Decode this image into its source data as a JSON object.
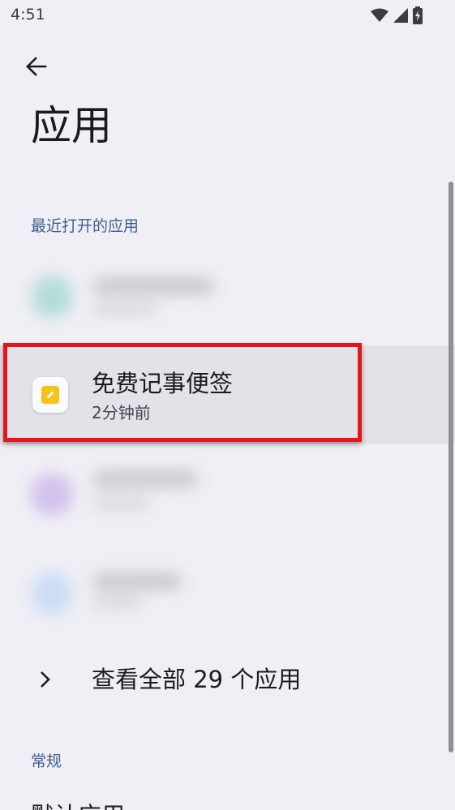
{
  "status_bar": {
    "time": "4:51",
    "icons": [
      "wifi-icon",
      "signal-icon",
      "battery-charging-icon"
    ]
  },
  "header": {
    "back_icon": "arrow-left-icon",
    "title": "应用"
  },
  "recent_section": {
    "header": "最近打开的应用",
    "highlighted_app": {
      "name": "免费记事便签",
      "time": "2分钟前",
      "icon": "note-pencil-icon",
      "icon_color": "#f8c21a"
    }
  },
  "see_all": {
    "label": "查看全部 29 个应用",
    "icon": "chevron-right-icon"
  },
  "general_section": {
    "header": "常规",
    "partial_item": "默认应用"
  },
  "colors": {
    "background": "#f0eff5",
    "accent": "#3d5f93",
    "highlight_border": "#e8141c"
  }
}
